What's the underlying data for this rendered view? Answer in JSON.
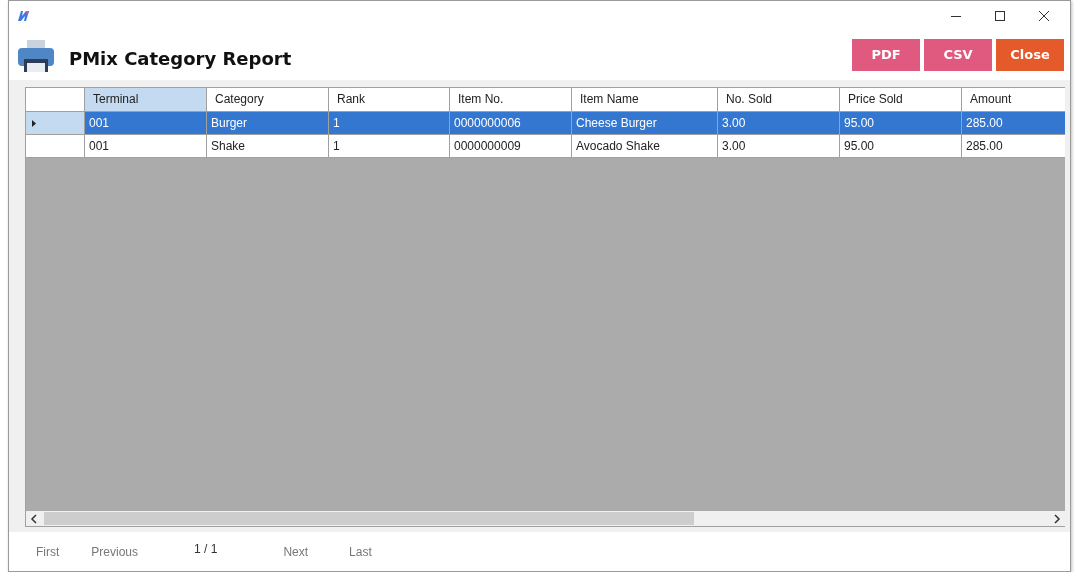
{
  "window": {
    "title": "PMix Category Report",
    "buttons": [
      {
        "label": "PDF",
        "kind": "export"
      },
      {
        "label": "CSV",
        "kind": "export"
      },
      {
        "label": "Close",
        "kind": "close"
      }
    ]
  },
  "table": {
    "columns": [
      {
        "label": "Terminal",
        "selected": true
      },
      {
        "label": "Category",
        "selected": false
      },
      {
        "label": "Rank",
        "selected": false
      },
      {
        "label": "Item No.",
        "selected": false
      },
      {
        "label": "Item Name",
        "selected": false
      },
      {
        "label": "No. Sold",
        "selected": false
      },
      {
        "label": "Price Sold",
        "selected": false
      },
      {
        "label": "Amount",
        "selected": false
      }
    ],
    "rows": [
      {
        "selected": true,
        "cells": [
          "001",
          "Burger",
          "1",
          "0000000006",
          "Cheese Burger",
          "3.00",
          "95.00",
          "285.00"
        ]
      },
      {
        "selected": false,
        "cells": [
          "001",
          "Shake",
          "1",
          "0000000009",
          "Avocado Shake",
          "3.00",
          "95.00",
          "285.00"
        ]
      }
    ]
  },
  "pager": {
    "first": "First",
    "previous": "Previous",
    "page": "1 / 1",
    "next": "Next",
    "last": "Last"
  }
}
